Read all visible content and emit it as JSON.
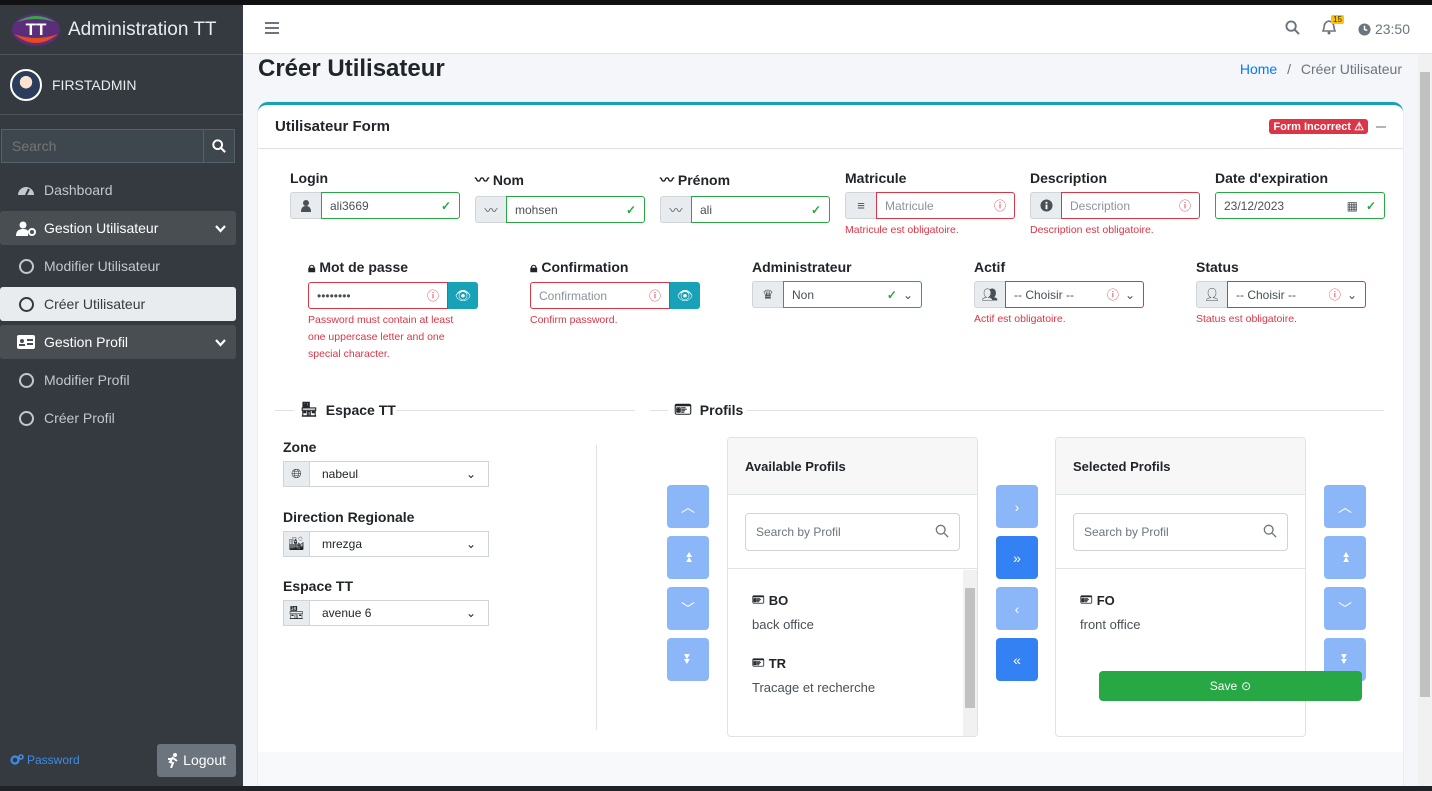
{
  "app": {
    "title": "Administration TT",
    "logo_text": "TT"
  },
  "user": {
    "name": "FIRSTADMIN"
  },
  "sidebar": {
    "search_placeholder": "Search",
    "items": [
      {
        "label": "Dashboard",
        "icon": "tachometer-icon"
      },
      {
        "label": "Gestion Utilisateur",
        "icon": "user-cog-icon"
      },
      {
        "label": "Modifier Utilisateur",
        "icon": "circle-icon"
      },
      {
        "label": "Créer Utilisateur",
        "icon": "circle-icon"
      },
      {
        "label": "Gestion Profil",
        "icon": "id-card-icon"
      },
      {
        "label": "Modifier Profil",
        "icon": "circle-icon"
      },
      {
        "label": "Créer Profil",
        "icon": "circle-icon"
      }
    ],
    "password_link": "Password",
    "logout": "Logout"
  },
  "topbar": {
    "notifications": "15",
    "time": "23:50"
  },
  "page": {
    "title": "Créer Utilisateur",
    "breadcrumb_home": "Home",
    "breadcrumb_sep": "/",
    "breadcrumb_current": "Créer Utilisateur"
  },
  "form": {
    "title": "Utilisateur Form",
    "status_badge": "Form Incorrect",
    "login": {
      "label": "Login",
      "value": "ali3669"
    },
    "nom": {
      "label": "Nom",
      "value": "mohsen"
    },
    "prenom": {
      "label": "Prénom",
      "value": "ali"
    },
    "matricule": {
      "label": "Matricule",
      "placeholder": "Matricule",
      "error": "Matricule est obligatoire."
    },
    "description": {
      "label": "Description",
      "placeholder": "Description",
      "error": "Description est obligatoire."
    },
    "date": {
      "label": "Date d'expiration",
      "value": "23/12/2023"
    },
    "password": {
      "label": "Mot de passe",
      "value": "••••••••",
      "error": "Password must contain at least one uppercase letter and one special character."
    },
    "confirmation": {
      "label": "Confirmation",
      "placeholder": "Confirmation",
      "error": "Confirm password."
    },
    "admin": {
      "label": "Administrateur",
      "value": "Non"
    },
    "actif": {
      "label": "Actif",
      "value": "-- Choisir --",
      "error": "Actif est obligatoire."
    },
    "status": {
      "label": "Status",
      "value": "-- Choisir --",
      "error": "Status est obligatoire."
    },
    "espace_section": "Espace TT",
    "profils_section": "Profils",
    "zone": {
      "label": "Zone",
      "value": "nabeul"
    },
    "direction": {
      "label": "Direction Regionale",
      "value": "mrezga"
    },
    "espace": {
      "label": "Espace TT",
      "value": "avenue 6"
    },
    "available": {
      "title": "Available Profils",
      "search_placeholder": "Search by Profil",
      "items": [
        {
          "code": "BO",
          "desc": "back office"
        },
        {
          "code": "TR",
          "desc": "Tracage et recherche"
        }
      ]
    },
    "selected": {
      "title": "Selected Profils",
      "search_placeholder": "Search by Profil",
      "items": [
        {
          "code": "FO",
          "desc": "front office"
        }
      ]
    },
    "save": "Save"
  },
  "colors": {
    "sidebar": "#343a40",
    "accent": "#17a2b8",
    "danger": "#dc3545",
    "success": "#28a745",
    "primary": "#007bff"
  }
}
